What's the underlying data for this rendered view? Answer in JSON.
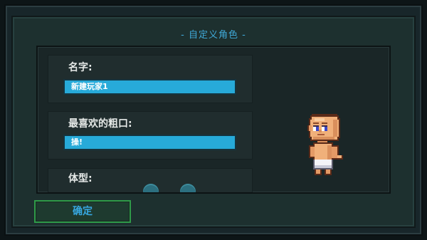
{
  "dialog": {
    "title": "- 自定义角色 -"
  },
  "fields": {
    "name": {
      "label": "名字:",
      "value": "新建玩家1"
    },
    "swear": {
      "label": "最喜欢的粗口:",
      "value": "操!"
    },
    "body": {
      "label": "体型:"
    }
  },
  "buttons": {
    "confirm_label": "确定"
  },
  "colors": {
    "accent_blue": "#27aad9",
    "title_blue": "#3fa9d8",
    "confirm_border": "#2f9a49"
  }
}
